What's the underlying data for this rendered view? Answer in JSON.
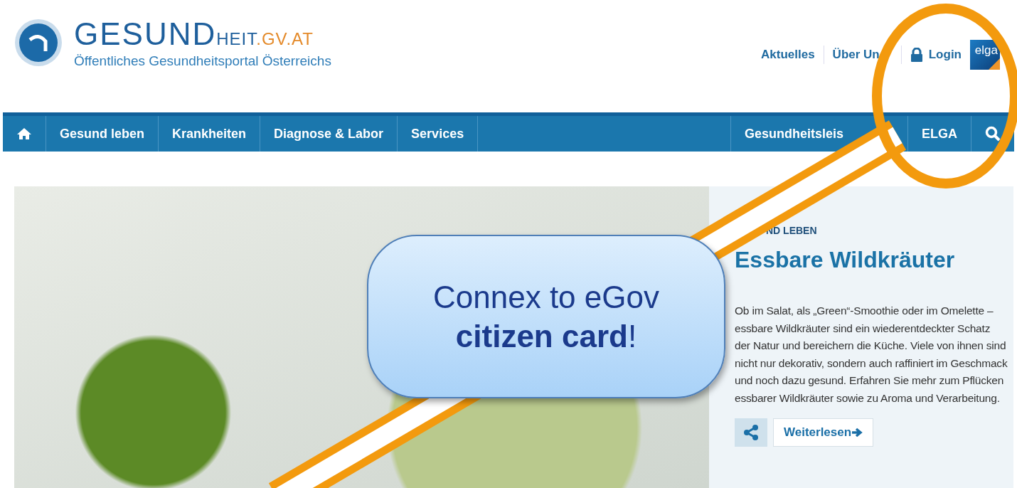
{
  "logo": {
    "title_main": "GESUND",
    "title_suffix": "HEIT",
    "domain": ".GV.AT",
    "subtitle": "Öffentliches Gesundheitsportal Österreichs"
  },
  "top_links": [
    {
      "label": "Aktuelles",
      "kind": "text"
    },
    {
      "label": "Über Un",
      "kind": "text"
    },
    {
      "label": "Login",
      "kind": "lock"
    }
  ],
  "elga_logo": "elga",
  "main_nav": {
    "left": [
      "Gesund leben",
      "Krankheiten",
      "Diagnose & Labor",
      "Services"
    ],
    "right": [
      "Gesundheitsleis",
      "ELGA"
    ]
  },
  "feature": {
    "category": "ND LEBEN",
    "title": "Essbare Wildkräuter",
    "text": "Ob im Salat, als „Green“-Smoothie oder im Omelette – essbare Wildkräuter sind ein wiederentdeckter Schatz der Natur und bereichern die Küche. Viele von ihnen sind nicht nur dekorativ, sondern auch raffiniert im Geschmack und noch dazu gesund. Erfahren Sie mehr zum Pflücken essbarer Wildkräuter sowie zu Aroma und Verarbeitung.",
    "button": "Weiterlesen"
  },
  "callout": {
    "lines": [
      "Connex to eGov",
      "**citizen card**!"
    ]
  }
}
